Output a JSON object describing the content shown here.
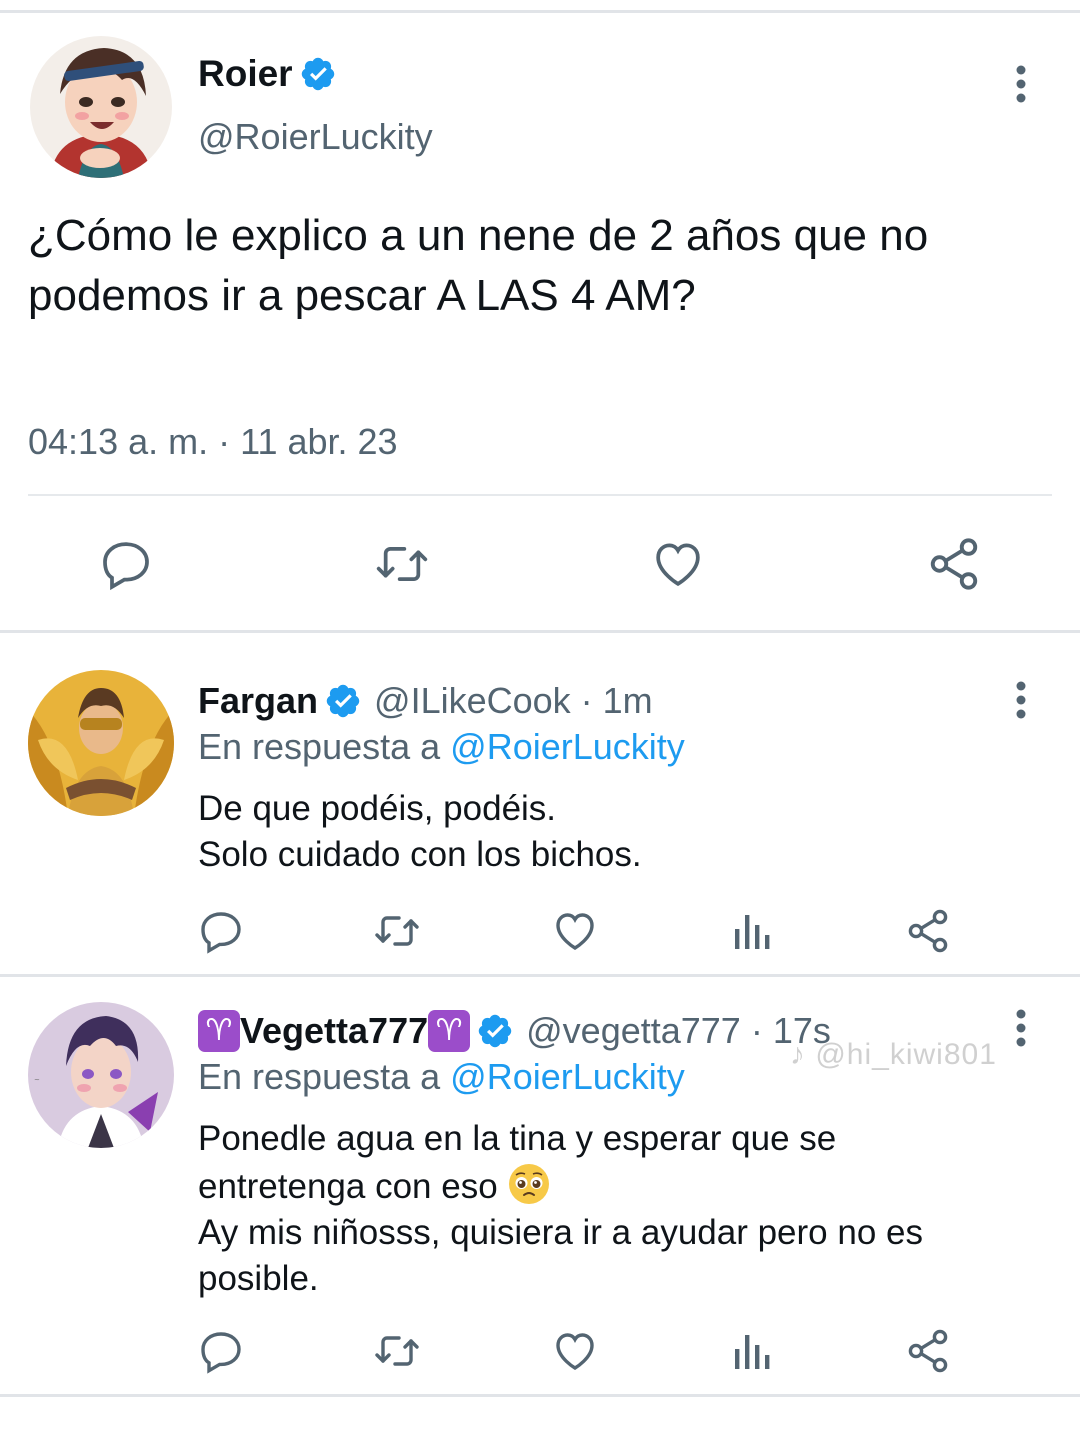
{
  "main_tweet": {
    "display_name": "Roier",
    "handle": "@RoierLuckity",
    "text": "¿Cómo le explico a un nene de 2 años que no podemos ir a pescar A LAS 4 AM?",
    "timestamp": "04:13 a. m. · 11 abr. 23",
    "actions": [
      "reply-icon",
      "retweet-icon",
      "like-icon",
      "share-icon"
    ]
  },
  "replies": [
    {
      "display_name": "Fargan",
      "meta": "@ILikeCook · 1m",
      "reply_prefix": "En respuesta a",
      "reply_mention": "@RoierLuckity",
      "body_line1": "De que podéis, podéis.",
      "body_line2": "Solo cuidado con los bichos.",
      "actions": [
        "reply-icon",
        "retweet-icon",
        "like-icon",
        "views-icon",
        "share-icon"
      ]
    },
    {
      "display_name": "Vegetta777",
      "zodiac": "♈",
      "meta": "@vegetta777 · 17s",
      "reply_prefix": "En respuesta a",
      "reply_mention": "@RoierLuckity",
      "body_line1": "Ponedle agua en la tina y esperar que se",
      "body_line2": "entretenga con eso",
      "body_line3": "Ay mis niñosss, quisiera ir a ayudar pero no es",
      "body_line4": "posible.",
      "actions": [
        "reply-icon",
        "retweet-icon",
        "like-icon",
        "views-icon",
        "share-icon"
      ]
    }
  ],
  "watermark": "@hi_kiwi801",
  "colors": {
    "text": "#0f1419",
    "secondary": "#536471",
    "link": "#1d9bf0",
    "verified": "#1d9bf0",
    "zodiac": "#9b4dca"
  }
}
